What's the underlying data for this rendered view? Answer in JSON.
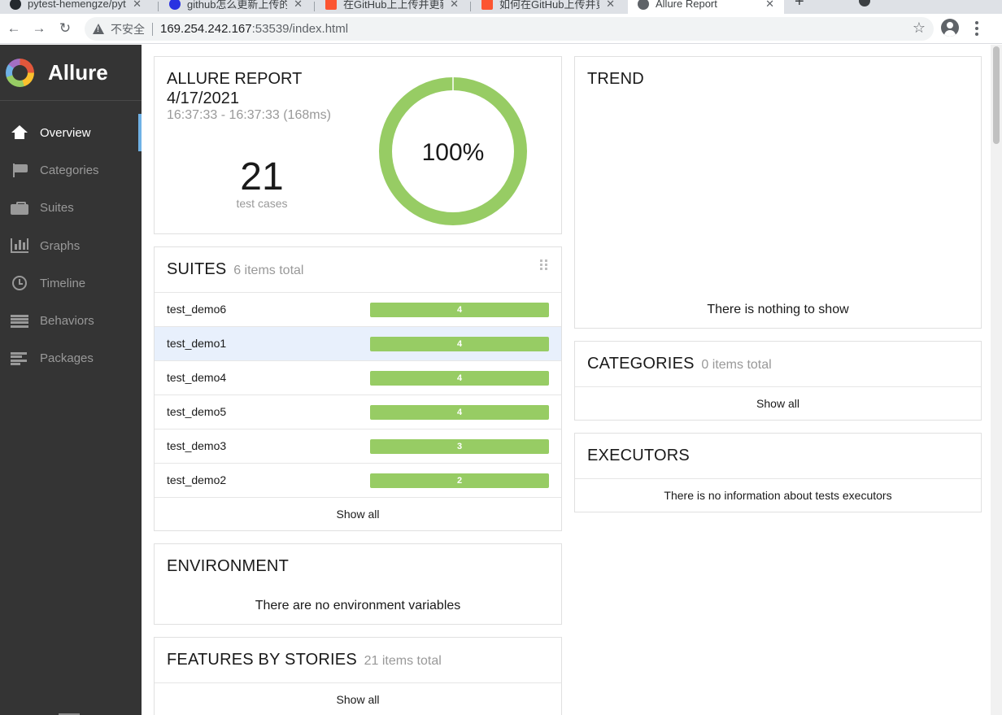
{
  "browser": {
    "tabs": [
      {
        "title": "pytest-hemengze/pyt"
      },
      {
        "title": "github怎么更新上传的文"
      },
      {
        "title": "在GitHub上上传并更新"
      },
      {
        "title": "如何在GitHub上传并更"
      },
      {
        "title": "Allure Report"
      }
    ],
    "new_tab": "+",
    "security_label": "不安全",
    "url_host": "169.254.242.167",
    "url_rest": ":53539/index.html"
  },
  "sidebar": {
    "brand": "Allure",
    "items": [
      {
        "label": "Overview",
        "icon": "home-icon"
      },
      {
        "label": "Categories",
        "icon": "flag-icon"
      },
      {
        "label": "Suites",
        "icon": "briefcase-icon"
      },
      {
        "label": "Graphs",
        "icon": "bar-chart-icon"
      },
      {
        "label": "Timeline",
        "icon": "clock-icon"
      },
      {
        "label": "Behaviors",
        "icon": "list-icon"
      },
      {
        "label": "Packages",
        "icon": "align-left-icon"
      }
    ],
    "active": "Overview"
  },
  "summary": {
    "title_line1": "ALLURE REPORT",
    "title_line2": "4/17/2021",
    "time_range": "16:37:33 - 16:37:33 (168ms)",
    "count": "21",
    "count_label": "test cases",
    "percent": "100%",
    "passed_fraction": 1.0
  },
  "suites": {
    "title": "SUITES",
    "count_label": "6 items total",
    "rows": [
      {
        "name": "test_demo6",
        "value": "4"
      },
      {
        "name": "test_demo1",
        "value": "4"
      },
      {
        "name": "test_demo4",
        "value": "4"
      },
      {
        "name": "test_demo5",
        "value": "4"
      },
      {
        "name": "test_demo3",
        "value": "3"
      },
      {
        "name": "test_demo2",
        "value": "2"
      }
    ],
    "show_all": "Show all"
  },
  "environment": {
    "title": "ENVIRONMENT",
    "message": "There are no environment variables"
  },
  "features": {
    "title": "FEATURES BY STORIES",
    "count_label": "21 items total",
    "show_all": "Show all"
  },
  "trend": {
    "title": "TREND",
    "message": "There is nothing to show"
  },
  "categories": {
    "title": "CATEGORIES",
    "count_label": "0 items total",
    "show_all": "Show all"
  },
  "executors": {
    "title": "EXECUTORS",
    "message": "There is no information about tests executors"
  },
  "colors": {
    "passed": "#97cc64",
    "sidebar_bg": "#343434",
    "accent": "#6fb1e5",
    "highlight_row": "#e8f0fc"
  }
}
